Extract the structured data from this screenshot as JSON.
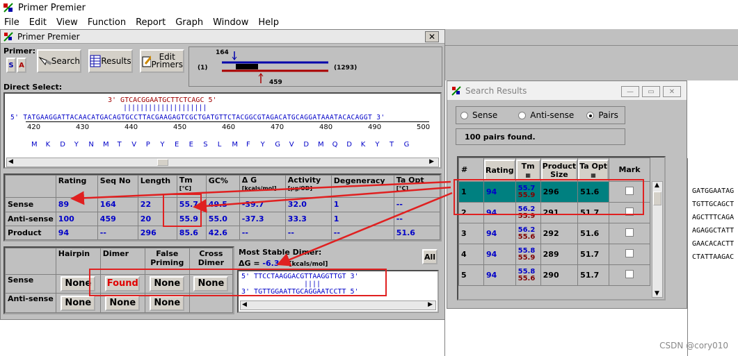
{
  "app": {
    "title": "Primer Premier",
    "menu": [
      "File",
      "Edit",
      "View",
      "Function",
      "Report",
      "Graph",
      "Window",
      "Help"
    ]
  },
  "main_window": {
    "title": "Primer Premier",
    "primer_label": "Primer:",
    "s_label": "S",
    "a_label": "A",
    "search_label": "Search",
    "results_label": "Results",
    "edit_primers_label": "Edit\nPrimers",
    "map": {
      "top_pos": "164",
      "left_pos": "(1)",
      "right_pos": "(1293)",
      "bottom_pos": "459"
    },
    "direct_select_label": "Direct Select:",
    "sequence": {
      "antisense_primer": "3' GTCACGGAATGCTTCTCAGC 5'",
      "match_bars": "||||||||||||||||||||",
      "sense_strand": "5' TATGAAGGATTACAACATGACAGTGCCTTACGAAGAGTCGCTGATGTTCTACGGCGTAGACATGCAGGATAAATACACAGGT 3'",
      "ruler": [
        "420",
        "430",
        "440",
        "450",
        "460",
        "470",
        "480",
        "490",
        "500"
      ],
      "translation": [
        "M",
        "K",
        "D",
        "Y",
        "N",
        "M",
        "T",
        "V",
        "P",
        "Y",
        "E",
        "E",
        "S",
        "L",
        "M",
        "F",
        "Y",
        "G",
        "V",
        "D",
        "M",
        "Q",
        "D",
        "K",
        "Y",
        "T",
        "G"
      ]
    },
    "props_table": {
      "headers": [
        "",
        "Rating",
        "Seq No",
        "Length",
        "Tm",
        "GC%",
        "Δ G",
        "Activity",
        "Degeneracy",
        "Ta Opt"
      ],
      "subheaders": {
        "Tm": "[°C]",
        "Δ G": "[kcals/mol]",
        "Activity": "[μg/OD]",
        "Ta Opt": "[°C]"
      },
      "rows": [
        {
          "label": "Sense",
          "cells": [
            "89",
            "164",
            "22",
            "55.7",
            "49.5",
            "-39.7",
            "32.0",
            "1",
            "--"
          ]
        },
        {
          "label": "Anti-sense",
          "cells": [
            "100",
            "459",
            "20",
            "55.9",
            "55.0",
            "-37.3",
            "33.3",
            "1",
            "--"
          ]
        },
        {
          "label": "Product",
          "cells": [
            "94",
            "--",
            "296",
            "85.6",
            "42.6",
            "--",
            "--",
            "--",
            "51.6"
          ]
        }
      ]
    },
    "struct_table": {
      "headers": [
        "",
        "Hairpin",
        "Dimer",
        "False\nPriming",
        "Cross\nDimer"
      ],
      "rows": [
        {
          "label": "Sense",
          "cells": [
            "None",
            "Found",
            "None",
            "None"
          ]
        },
        {
          "label": "Anti-sense",
          "cells": [
            "None",
            "None",
            "None",
            ""
          ]
        }
      ]
    },
    "dimer": {
      "title": "Most Stable Dimer:",
      "dg_label": "ΔG = ",
      "dg_value": "-6.3",
      "dg_unit": "[kcals/mol]",
      "all_label": "All",
      "line1": "5' TTCCTAAGGACGTTAAGGTTGT 3'",
      "bars": "||||",
      "line2": "3' TGTTGGAATTGCAGGAATCCTT 5'"
    }
  },
  "search_results": {
    "title": "Search Results",
    "radios": [
      "Sense",
      "Anti-sense",
      "Pairs"
    ],
    "selected_radio": "Pairs",
    "found_text": "100 pairs found.",
    "headers": [
      "#",
      "Rating",
      "Tm",
      "Product\nSize",
      "Ta Opt",
      "Mark"
    ],
    "rows": [
      {
        "n": "1",
        "rating": "94",
        "tm1": "55.7",
        "tm2": "55.9",
        "size": "296",
        "ta": "51.6"
      },
      {
        "n": "2",
        "rating": "94",
        "tm1": "56.2",
        "tm2": "55.9",
        "size": "291",
        "ta": "51.7"
      },
      {
        "n": "3",
        "rating": "94",
        "tm1": "56.2",
        "tm2": "55.6",
        "size": "292",
        "ta": "51.6"
      },
      {
        "n": "4",
        "rating": "94",
        "tm1": "55.8",
        "tm2": "55.9",
        "size": "289",
        "ta": "51.7"
      },
      {
        "n": "5",
        "rating": "94",
        "tm1": "55.8",
        "tm2": "55.6",
        "size": "290",
        "ta": "51.7"
      }
    ]
  },
  "right_sequences": [
    "GATGGAATAG",
    "TGTTGCAGCT",
    "AGCTTTCAGA",
    "AGAGGCTATT",
    "GAACACACTT",
    "CTATTAAGAC"
  ],
  "watermark": "CSDN @cory010",
  "colors": {
    "highlight_row": "#008080",
    "annotation": "#e02020",
    "value_blue": "#0000c8",
    "value_red": "#800000"
  }
}
